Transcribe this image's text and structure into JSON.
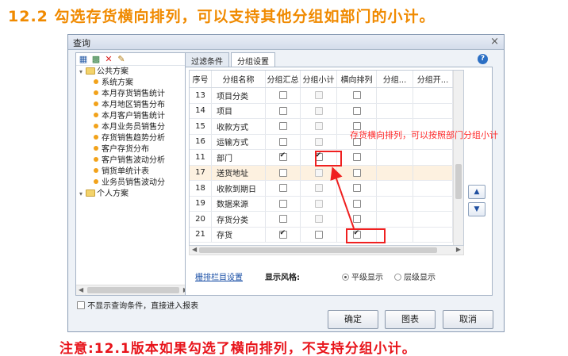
{
  "headline": "12.2 勾选存货横向排列，可以支持其他分组如部门的小计。",
  "footnote": "注意:12.1版本如果勾选了横向排列，不支持分组小计。",
  "dialog": {
    "title": "查询",
    "close_symbol": "×",
    "toolbar_icons": [
      "save-icon",
      "save-as-icon",
      "delete-icon",
      "edit-icon"
    ],
    "tree": {
      "public_root": "公共方案",
      "public_items": [
        "系统方案",
        "本月存货销售统计",
        "本月地区销售分布",
        "本月客户销售统计",
        "本月业务员销售分",
        "存货销售趋势分析",
        "客户存货分布",
        "客户销售波动分析",
        "销货单统计表",
        "业务员销售波动分"
      ],
      "personal_root": "个人方案"
    },
    "no_condition_label": "不显示查询条件，直接进入报表",
    "tabs": [
      "过滤条件",
      "分组设置"
    ],
    "active_tab": "分组设置",
    "help_label": "?",
    "grid": {
      "headers": [
        "序号",
        "分组名称",
        "分组汇总",
        "分组小计",
        "横向排列",
        "分组...",
        "分组开..."
      ],
      "rows": [
        {
          "no": "13",
          "name": "项目分类",
          "sum": false,
          "sub": false,
          "sub_enabled": false,
          "horiz": false
        },
        {
          "no": "14",
          "name": "项目",
          "sum": false,
          "sub": false,
          "sub_enabled": false,
          "horiz": false
        },
        {
          "no": "15",
          "name": "收款方式",
          "sum": false,
          "sub": false,
          "sub_enabled": false,
          "horiz": false
        },
        {
          "no": "16",
          "name": "运输方式",
          "sum": false,
          "sub": false,
          "sub_enabled": false,
          "horiz": false
        },
        {
          "no": "11",
          "name": "部门",
          "sum": true,
          "sub": true,
          "sub_enabled": true,
          "horiz": false
        },
        {
          "no": "17",
          "name": "送货地址",
          "sum": false,
          "sub": false,
          "sub_enabled": false,
          "horiz": false
        },
        {
          "no": "18",
          "name": "收款到期日",
          "sum": false,
          "sub": false,
          "sub_enabled": false,
          "horiz": false
        },
        {
          "no": "19",
          "name": "数据来源",
          "sum": false,
          "sub": false,
          "sub_enabled": false,
          "horiz": false
        },
        {
          "no": "20",
          "name": "存货分类",
          "sum": false,
          "sub": false,
          "sub_enabled": false,
          "horiz": false
        },
        {
          "no": "21",
          "name": "存货",
          "sum": true,
          "sub": false,
          "sub_enabled": true,
          "horiz": true
        }
      ]
    },
    "move_up": "▲",
    "move_down": "▼",
    "layout_link": "栅排栏目设置",
    "style_label": "显示风格:",
    "style_options": [
      {
        "label": "平级显示",
        "selected": true
      },
      {
        "label": "层级显示",
        "selected": false
      }
    ],
    "buttons": {
      "ok": "确定",
      "chart": "图表",
      "cancel": "取消"
    }
  },
  "annotation": {
    "text": "存货横向排列，可以按照部门分组小计",
    "color": "#ff2a2a"
  }
}
